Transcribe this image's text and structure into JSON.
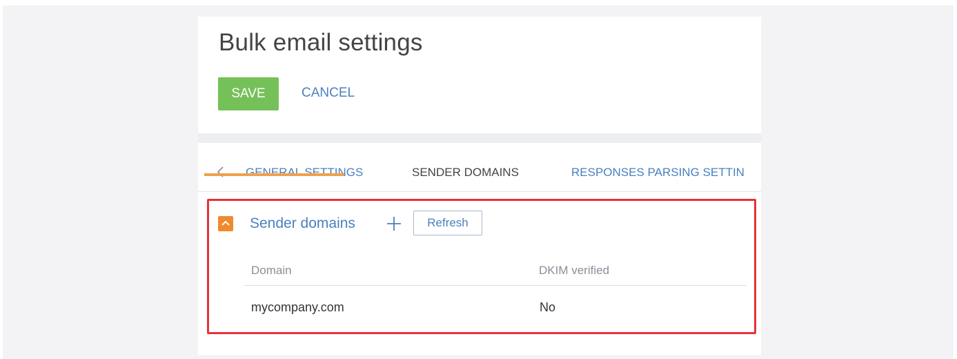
{
  "page": {
    "title": "Bulk email settings"
  },
  "toolbar": {
    "save_label": "SAVE",
    "cancel_label": "CANCEL"
  },
  "tabs": {
    "prev_icon": "chevron-left-icon",
    "items": [
      {
        "label": "GENERAL SETTINGS",
        "active": false
      },
      {
        "label": "SENDER DOMAINS",
        "active": true
      },
      {
        "label": "RESPONSES PARSING SETTIN",
        "active": false
      }
    ]
  },
  "sender_domains": {
    "title": "Sender domains",
    "collapse_icon": "chevron-up-icon",
    "add_icon": "plus-icon",
    "refresh_label": "Refresh",
    "columns": [
      "Domain",
      "DKIM verified"
    ],
    "rows": [
      {
        "domain": "mycompany.com",
        "dkim_verified": "No"
      }
    ]
  },
  "colors": {
    "save_green": "#76c05a",
    "link_blue": "#4b7fbf",
    "tab_active_underline": "#f0a04b",
    "collapse_orange": "#f08a2c",
    "highlight_red": "#e8313a"
  }
}
